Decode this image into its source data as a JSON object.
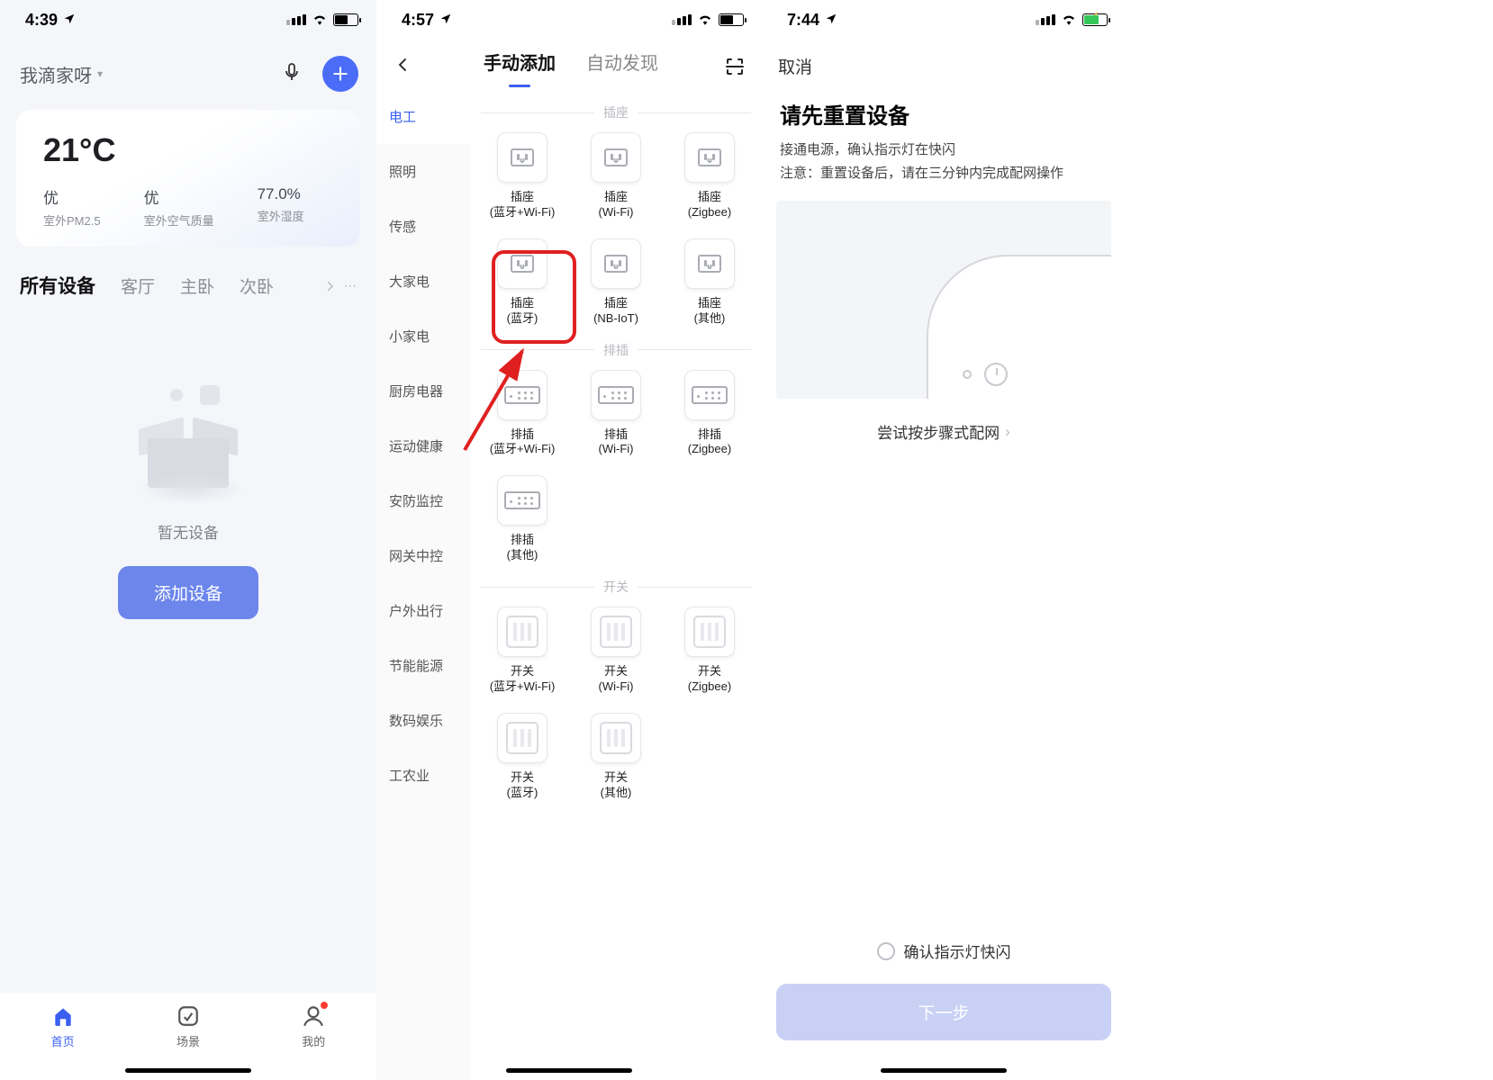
{
  "phone1": {
    "statusTime": "4:39",
    "homeName": "我滴家呀",
    "weather": {
      "temp": "21°C",
      "items": [
        {
          "value": "优",
          "label": "室外PM2.5"
        },
        {
          "value": "优",
          "label": "室外空气质量"
        },
        {
          "value": "77.0%",
          "label": "室外湿度"
        }
      ]
    },
    "roomTabs": [
      "所有设备",
      "客厅",
      "主卧",
      "次卧"
    ],
    "moreDots": "⋯",
    "emptyText": "暂无设备",
    "addDeviceBtn": "添加设备",
    "bottomTabs": [
      {
        "label": "首页"
      },
      {
        "label": "场景"
      },
      {
        "label": "我的"
      }
    ]
  },
  "phone2": {
    "statusTime": "4:57",
    "navTabs": {
      "manual": "手动添加",
      "auto": "自动发现"
    },
    "categories": [
      "电工",
      "照明",
      "传感",
      "大家电",
      "小家电",
      "厨房电器",
      "运动健康",
      "安防监控",
      "网关中控",
      "户外出行",
      "节能能源",
      "数码娱乐",
      "工农业"
    ],
    "sections": {
      "socket": {
        "title": "插座",
        "items": [
          {
            "name": "插座",
            "sub": "(蓝牙+Wi-Fi)"
          },
          {
            "name": "插座",
            "sub": "(Wi-Fi)"
          },
          {
            "name": "插座",
            "sub": "(Zigbee)"
          },
          {
            "name": "插座",
            "sub": "(蓝牙)"
          },
          {
            "name": "插座",
            "sub": "(NB-IoT)"
          },
          {
            "name": "插座",
            "sub": "(其他)"
          }
        ]
      },
      "strip": {
        "title": "排插",
        "items": [
          {
            "name": "排插",
            "sub": "(蓝牙+Wi-Fi)"
          },
          {
            "name": "排插",
            "sub": "(Wi-Fi)"
          },
          {
            "name": "排插",
            "sub": "(Zigbee)"
          },
          {
            "name": "排插",
            "sub": "(其他)"
          }
        ]
      },
      "switch": {
        "title": "开关",
        "items": [
          {
            "name": "开关",
            "sub": "(蓝牙+Wi-Fi)"
          },
          {
            "name": "开关",
            "sub": "(Wi-Fi)"
          },
          {
            "name": "开关",
            "sub": "(Zigbee)"
          },
          {
            "name": "开关",
            "sub": "(蓝牙)"
          },
          {
            "name": "开关",
            "sub": "(其他)"
          }
        ]
      }
    }
  },
  "phone3": {
    "statusTime": "7:44",
    "cancel": "取消",
    "resetTitle": "请先重置设备",
    "resetLine1": "接通电源，确认指示灯在快闪",
    "resetLine2": "注意：重置设备后，请在三分钟内完成配网操作",
    "tryStep": "尝试按步骤式配网",
    "confirmLabel": "确认指示灯快闪",
    "nextBtn": "下一步"
  }
}
